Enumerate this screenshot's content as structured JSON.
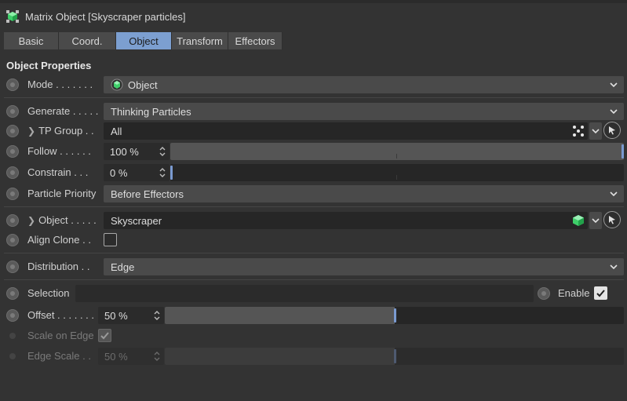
{
  "header": {
    "title": "Matrix Object [Skyscraper particles]",
    "icon": "matrix-object-icon"
  },
  "tabs": [
    {
      "label": "Basic",
      "active": false
    },
    {
      "label": "Coord.",
      "active": false
    },
    {
      "label": "Object",
      "active": true
    },
    {
      "label": "Transform",
      "active": false
    },
    {
      "label": "Effectors",
      "active": false
    }
  ],
  "section": {
    "title": "Object Properties"
  },
  "fields": {
    "mode": {
      "label": "Mode . . . . . . .",
      "value": "Object"
    },
    "generate": {
      "label": "Generate . . . . .",
      "value": "Thinking Particles"
    },
    "tp_group": {
      "label": "TP Group . .",
      "value": "All"
    },
    "follow": {
      "label": "Follow . . . . . .",
      "value": "100 %",
      "fraction": 1.0
    },
    "constrain": {
      "label": "Constrain . . .",
      "value": "0 %",
      "fraction": 0.0
    },
    "particle_priority": {
      "label": "Particle Priority",
      "value": "Before Effectors"
    },
    "object": {
      "label": "Object . . . . .",
      "value": "Skyscraper"
    },
    "align_clone": {
      "label": "Align Clone . .",
      "checked": false
    },
    "distribution": {
      "label": "Distribution . .",
      "value": "Edge"
    },
    "selection": {
      "label": "Selection",
      "value": ""
    },
    "enable": {
      "label": "Enable",
      "checked": true
    },
    "offset": {
      "label": "Offset . . . . . . .",
      "value": "50 %",
      "fraction": 0.5
    },
    "scale_on_edge": {
      "label": "Scale on Edge",
      "checked": true
    },
    "edge_scale": {
      "label": "Edge Scale . .",
      "value": "50 %",
      "fraction": 0.5
    }
  },
  "colors": {
    "background": "#333333",
    "accent": "#7c9fd0",
    "icon_green": "#3fcf6a"
  }
}
